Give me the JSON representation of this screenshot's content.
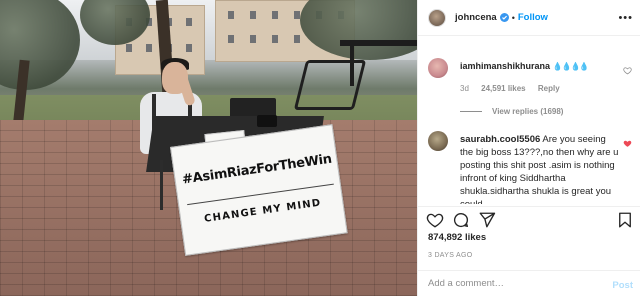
{
  "photo": {
    "sign_hashtag": "#AsimRiazForTheWin",
    "sign_subtitle": "CHANGE MY MIND"
  },
  "header": {
    "username": "johncena",
    "separator": "•",
    "follow_label": "Follow",
    "more_label": "•••"
  },
  "comments": [
    {
      "username": "iamhimanshikhurana",
      "text": "💧💧💧💧",
      "age": "3d",
      "likes": "24,591 likes",
      "reply_label": "Reply",
      "view_replies": "View replies (1698)",
      "liked": false,
      "avatar_color": "#c98a8f"
    },
    {
      "username": "saurabh.cool5506",
      "text": "Are you seeing the big boss 13???,no then why are u posting this shit post .asim is nothing infront of king Siddhartha shukla.sidhartha shukla is great you could",
      "liked": true,
      "avatar_color": "#7a6a52"
    }
  ],
  "likes": "874,892 likes",
  "date": "3 DAYS AGO",
  "add_comment": {
    "placeholder": "Add a comment…",
    "post_label": "Post"
  },
  "colors": {
    "accent": "#0095f6",
    "like_red": "#ed4956",
    "muted": "#8e8e8e"
  },
  "icons": [
    "verified-badge-icon",
    "heart-icon",
    "comment-icon",
    "share-icon",
    "bookmark-icon",
    "more-icon"
  ]
}
